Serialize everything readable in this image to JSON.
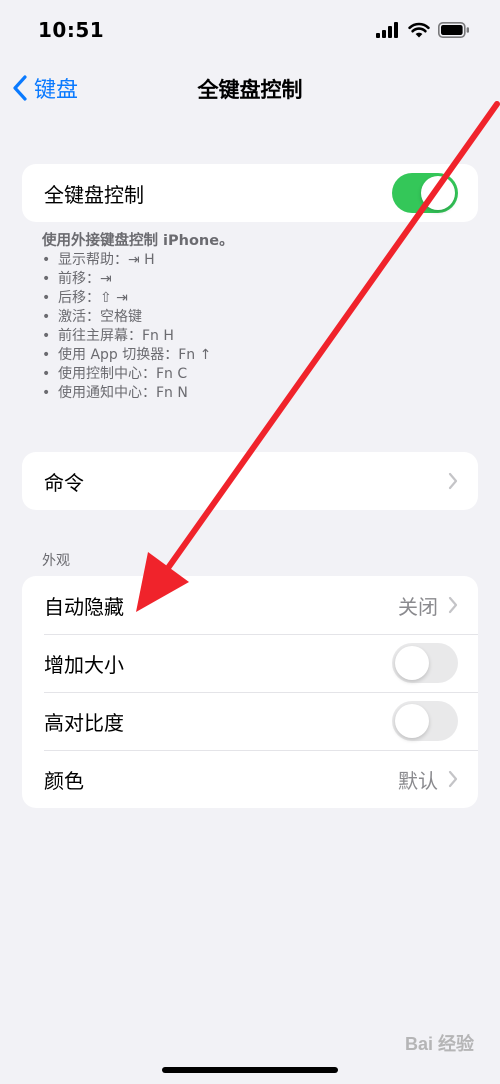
{
  "status_bar": {
    "time": "10:51"
  },
  "nav": {
    "back_label": "键盘",
    "title": "全键盘控制"
  },
  "main_toggle": {
    "label": "全键盘控制",
    "state": "on"
  },
  "description": {
    "intro": "使用外接键盘控制 iPhone。",
    "items": [
      "显示帮助：⇥ H",
      "前移：⇥",
      "后移：⇧ ⇥",
      "激活：空格键",
      "前往主屏幕：Fn H",
      "使用 App 切换器：Fn ↑",
      "使用控制中心：Fn C",
      "使用通知中心：Fn N"
    ]
  },
  "commands": {
    "label": "命令"
  },
  "appearance": {
    "header": "外观",
    "rows": [
      {
        "label": "自动隐藏",
        "value": "关闭"
      },
      {
        "label": "增加大小",
        "state": "off"
      },
      {
        "label": "高对比度",
        "state": "off"
      },
      {
        "label": "颜色",
        "value": "默认"
      }
    ]
  },
  "watermark": {
    "text": "Bai 经验"
  },
  "colors": {
    "accent": "#0a7aff",
    "toggle_on": "#34c759",
    "arrow": "#f0232b",
    "background": "#f2f2f6"
  }
}
